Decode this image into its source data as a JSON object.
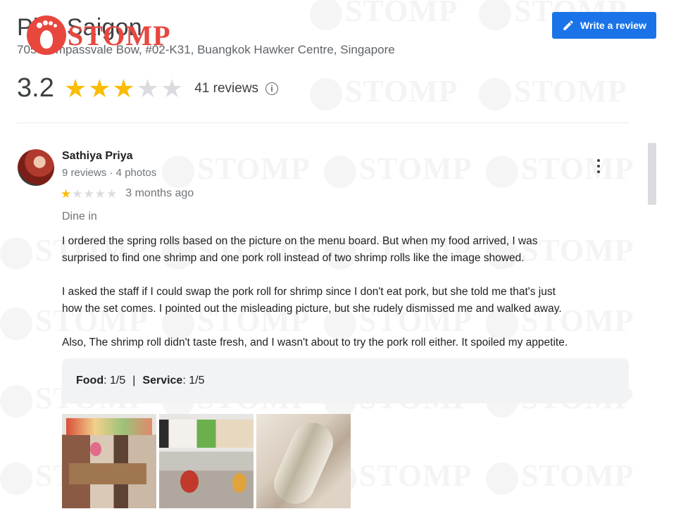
{
  "watermark": {
    "text": "STOMP"
  },
  "header": {
    "place_title": "Pho Saigon",
    "address": "705 Compassvale Bow, #02-K31, Buangkok Hawker Centre, Singapore",
    "write_review_label": "Write a review",
    "logo_text": "STOMP"
  },
  "summary": {
    "rating": "3.2",
    "stars": 3,
    "stars_total": 5,
    "reviews_count": "41 reviews"
  },
  "review": {
    "reviewer_name": "Sathiya Priya",
    "reviewer_meta": "9 reviews · 4 photos",
    "stars": 1,
    "time": "3 months ago",
    "dine_type": "Dine in",
    "paragraphs": [
      "I ordered the spring rolls based on the picture on the menu board. But when my food arrived, I was",
      "surprised to find one shrimp and one pork roll instead of two shrimp rolls like the image showed.",
      "I asked the staff if I could swap the pork roll for shrimp since I don't eat pork, but she told me that's just",
      "how the set comes. I pointed out the misleading picture, but she rudely dismissed me and walked away.",
      "Also, The shrimp roll didn't taste fresh, and I wasn't about to try the pork roll either. It spoiled my appetite."
    ],
    "ratings": {
      "food_label": "Food",
      "food_value": ": 1/5",
      "separator": "|",
      "service_label": "Service",
      "service_value": ": 1/5"
    }
  },
  "colors": {
    "accent": "#1a73e8",
    "star_on": "#fbbc04",
    "star_off": "#dadce0",
    "logo_red": "#e8473e"
  }
}
